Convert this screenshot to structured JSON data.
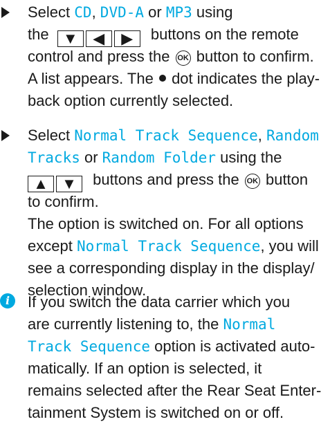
{
  "step1": {
    "t_select": "Select ",
    "cd": "CD",
    "comma": ", ",
    "dvd": "DVD-A",
    "or": " or ",
    "mp3": "MP3",
    "using": " using",
    "the": "the",
    "buttons_remote": "buttons on the remote",
    "control_press": "control and press the",
    "button_confirm": "button to confirm.",
    "list_appears_1": "A list appears. The",
    "list_appears_2": "dot indicates the play-",
    "playback": "back option currently selected."
  },
  "step2": {
    "t_select": "Select ",
    "normal": "Normal Track Sequence",
    "comma": ", ",
    "random_a": "Random",
    "random_b": "Tracks",
    "or": " or ",
    "random_folder": "Random Folder",
    "using": " using the",
    "buttons_press": "buttons and press the",
    "button": "button",
    "to_confirm": "to confirm.",
    "switched_on": "The option is switched on. For all options",
    "except": "except ",
    "normal2": "Normal Track Sequence",
    "you_will": ", you will",
    "see": "see a corresponding display in the display/",
    "selection": "selection window."
  },
  "note": {
    "icon": "i",
    "l1": "If you switch the data carrier which you",
    "l2": "are currently listening to, the ",
    "normal_a": "Normal",
    "normal_b": "Track Sequence",
    "l3": " option is activated auto-",
    "l4": "matically. If an option is selected, it",
    "l5": "remains selected after the Rear Seat Enter-",
    "l6": "tainment System is switched on or off."
  },
  "buttons": {
    "ok_label": "OK",
    "down_icon": "▼",
    "left_icon": "◀",
    "right_icon": "▶",
    "up_icon": "▲"
  }
}
